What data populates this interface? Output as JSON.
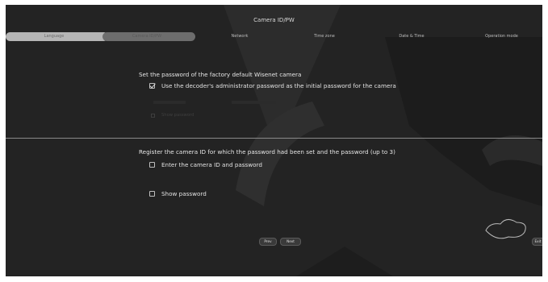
{
  "title": "Camera ID/PW",
  "steps": [
    {
      "label": "Language",
      "state": "done"
    },
    {
      "label": "Camera ID/PW",
      "state": "current"
    },
    {
      "label": "Network",
      "state": "pending"
    },
    {
      "label": "Time zone",
      "state": "pending"
    },
    {
      "label": "Date & Time",
      "state": "pending"
    },
    {
      "label": "Operation mode",
      "state": "pending"
    }
  ],
  "password_section": {
    "heading": "Set the password of the factory default Wisenet camera",
    "use_admin_label": "Use the decoder's administrator password as the initial password for the camera",
    "use_admin_checked": true,
    "faded_show_password": "Show password"
  },
  "register_section": {
    "heading": "Register the camera ID for which the password had been set and the password (up to 3)",
    "enter_id_label": "Enter the camera ID and password",
    "enter_id_checked": false,
    "show_password_label": "Show password",
    "show_password_checked": false
  },
  "buttons": {
    "prev": "Prev",
    "next": "Next",
    "exit": "Exit"
  }
}
